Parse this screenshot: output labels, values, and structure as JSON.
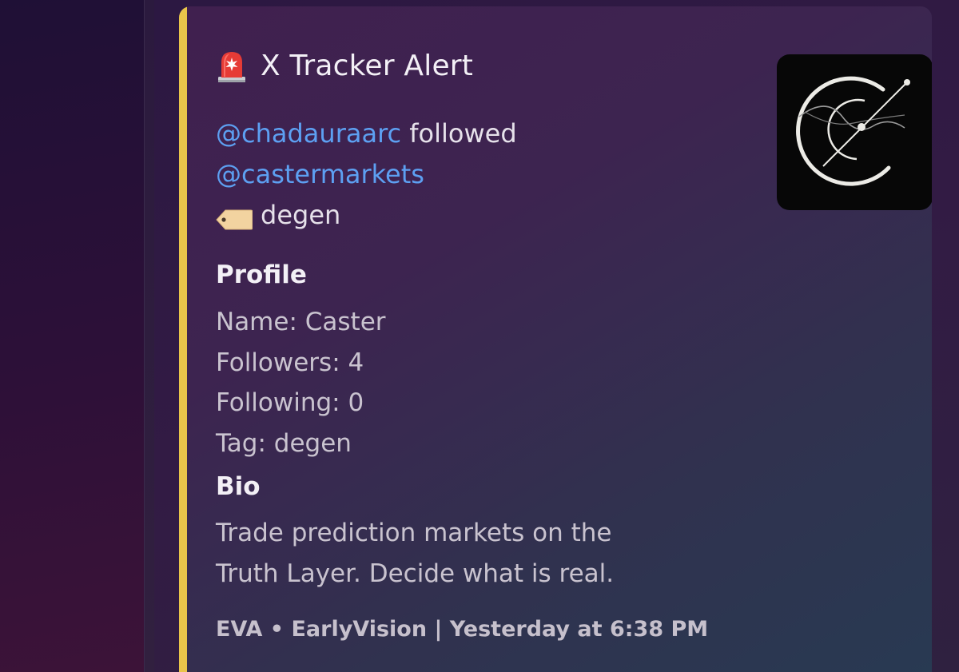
{
  "embed": {
    "accent_color": "#e9c44a",
    "title_icon": "siren-icon",
    "title": "X Tracker Alert",
    "event": {
      "follower": "@chadauraarc",
      "action": "followed",
      "followed": "@castermarkets",
      "tag_icon": "label-icon",
      "tag": "degen"
    },
    "profile": {
      "heading": "Profile",
      "name": "Name: Caster",
      "followers": "Followers: 4",
      "following": "Following: 0",
      "tag": "Tag: degen"
    },
    "bio": {
      "heading": "Bio",
      "line1": "Trade prediction markets on the",
      "line2": "Truth Layer. Decide what is real."
    },
    "footer": "EVA • EarlyVision | Yesterday at 6:38 PM",
    "thumbnail_icon": "caster-logo-icon"
  }
}
